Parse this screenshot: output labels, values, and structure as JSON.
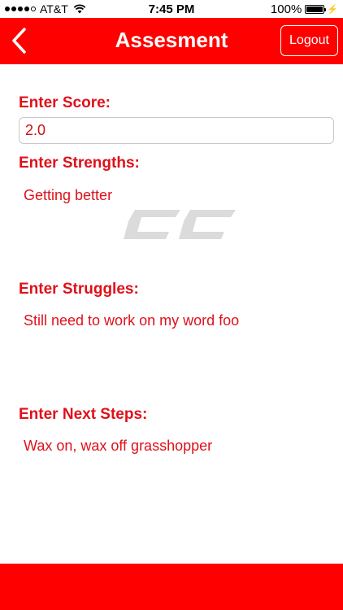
{
  "status_bar": {
    "carrier": "AT&T",
    "time": "7:45 PM",
    "battery": "100%"
  },
  "nav": {
    "title": "Assesment",
    "logout_label": "Logout"
  },
  "form": {
    "score_label": "Enter Score:",
    "score_value": "2.0",
    "strengths_label": "Enter Strengths:",
    "strengths_value": "Getting better",
    "struggles_label": "Enter Struggles:",
    "struggles_value": "Still need to work on my word foo",
    "next_steps_label": "Enter Next Steps:",
    "next_steps_value": "Wax on, wax off grasshopper"
  },
  "colors": {
    "brand_red": "#ff0000",
    "text_red": "#e0101a"
  }
}
